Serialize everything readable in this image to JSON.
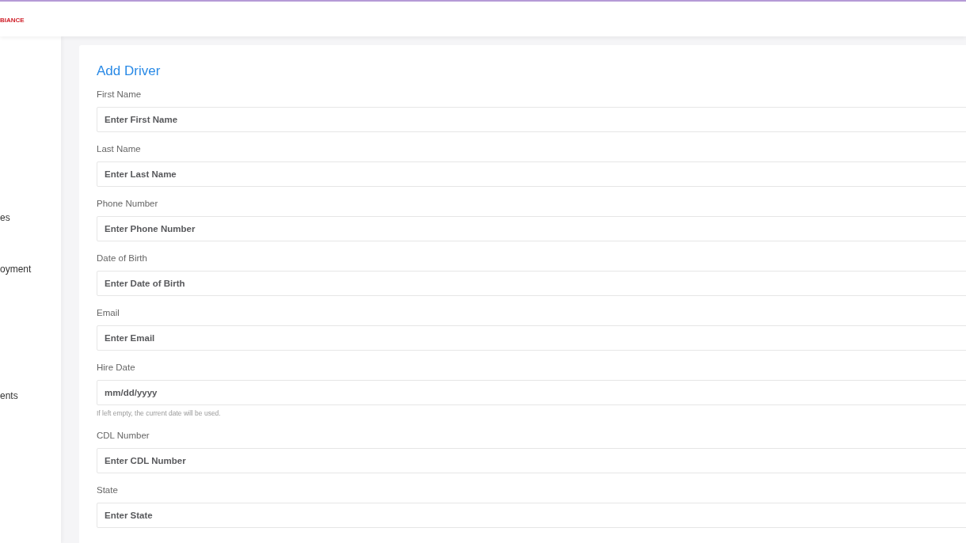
{
  "header": {
    "logo_text": "BIANCE"
  },
  "sidebar": {
    "items": [
      {
        "label": "es"
      },
      {
        "label": "oyment"
      },
      {
        "label": "ents"
      }
    ]
  },
  "form": {
    "title": "Add Driver",
    "fields": [
      {
        "label": "First Name",
        "placeholder": "Enter First Name"
      },
      {
        "label": "Last Name",
        "placeholder": "Enter Last Name"
      },
      {
        "label": "Phone Number",
        "placeholder": "Enter Phone Number"
      },
      {
        "label": "Date of Birth",
        "placeholder": "Enter Date of Birth"
      },
      {
        "label": "Email",
        "placeholder": "Enter Email"
      },
      {
        "label": "Hire Date",
        "placeholder": "mm/dd/yyyy",
        "help": "If left empty, the current date will be used."
      },
      {
        "label": "CDL Number",
        "placeholder": "Enter CDL Number"
      },
      {
        "label": "State",
        "placeholder": "Enter State"
      }
    ]
  }
}
